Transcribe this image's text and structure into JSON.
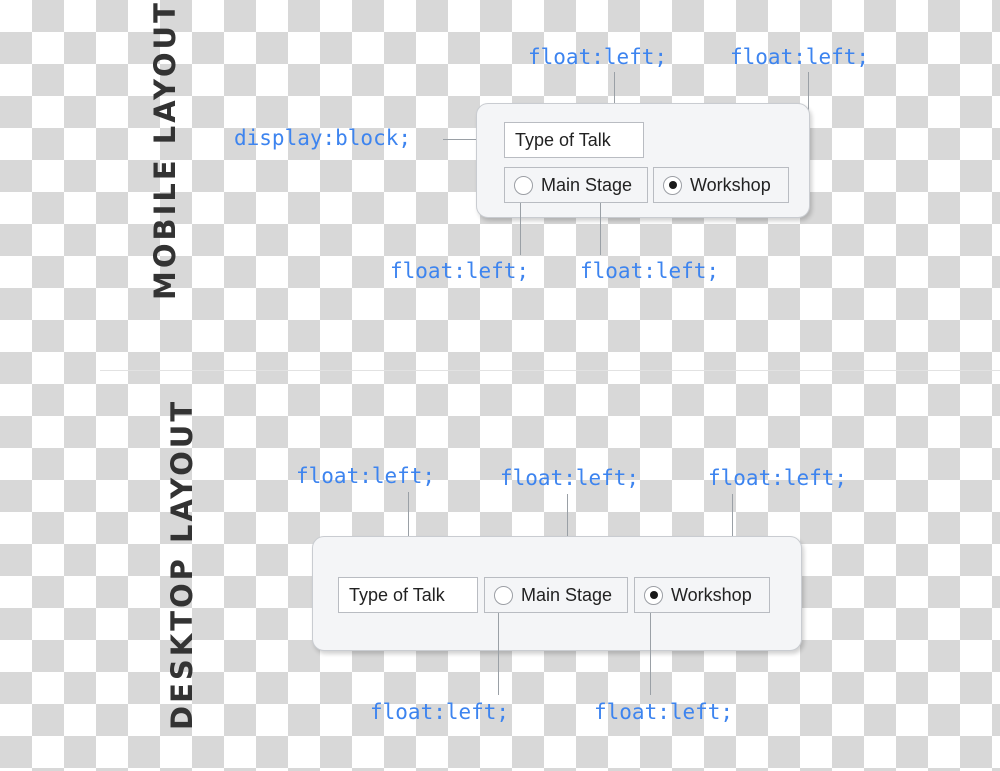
{
  "sections": [
    {
      "id": "mobile",
      "label": "MOBILE LAYOUT",
      "annotations": {
        "display_block": "display:block;",
        "top_left": "float:left;",
        "top_right": "float:left;",
        "bottom_left": "float:left;",
        "bottom_right": "float:left;"
      },
      "form": {
        "text_field_label": "Type of Talk",
        "radio_options": [
          {
            "label": "Main Stage",
            "checked": false
          },
          {
            "label": "Workshop",
            "checked": true
          }
        ]
      }
    },
    {
      "id": "desktop",
      "label": "DESKTOP LAYOUT",
      "annotations": {
        "top_left": "float:left;",
        "top_middle": "float:left;",
        "top_right": "float:left;",
        "bottom_left": "float:left;",
        "bottom_right": "float:left;"
      },
      "form": {
        "text_field_label": "Type of Talk",
        "radio_options": [
          {
            "label": "Main Stage",
            "checked": false
          },
          {
            "label": "Workshop",
            "checked": true
          }
        ]
      }
    }
  ],
  "colors": {
    "annotation": "#3d84ef",
    "label": "#333333",
    "leader": "#9aa0a6",
    "panel_bg": "#f4f5f7",
    "panel_border": "#c9ccd1"
  }
}
